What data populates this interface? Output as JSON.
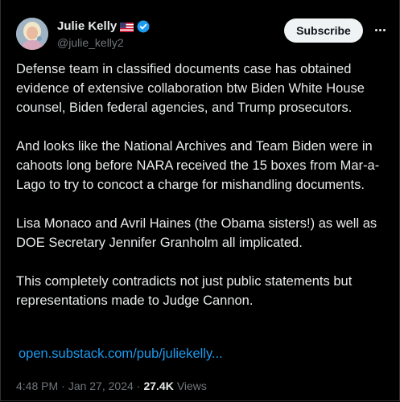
{
  "tweet": {
    "author_name": "Julie Kelly",
    "author_handle": "@julie_kelly2",
    "subscribe_label": "Subscribe",
    "paragraphs": [
      "Defense team in classified documents case has obtained evidence of extensive collaboration btw Biden White House counsel, Biden federal agencies, and Trump prosecutors.",
      "And looks like the National Archives and Team Biden were in cahoots long before NARA received the 15 boxes from Mar-a-Lago to try to concoct a charge for mishandling documents.",
      "Lisa Monaco and Avril Haines (the Obama sisters!) as well as DOE Secretary Jennifer Granholm all implicated.",
      "This completely contradicts not just public statements but representations made to Judge Cannon."
    ],
    "link_text": "open.substack.com/pub/juliekelly...",
    "time": "4:48 PM",
    "separator": "·",
    "date": "Jan 27, 2024",
    "views_count": "27.4K",
    "views_label": "Views"
  },
  "icons": {
    "flag": "us-flag-icon",
    "verified": "verified-badge-icon",
    "more": "more-options-icon"
  },
  "colors": {
    "background": "#000000",
    "text": "#e7e9ea",
    "secondary": "#71767b",
    "link": "#1d9bf0",
    "button_bg": "#eff3f4"
  }
}
